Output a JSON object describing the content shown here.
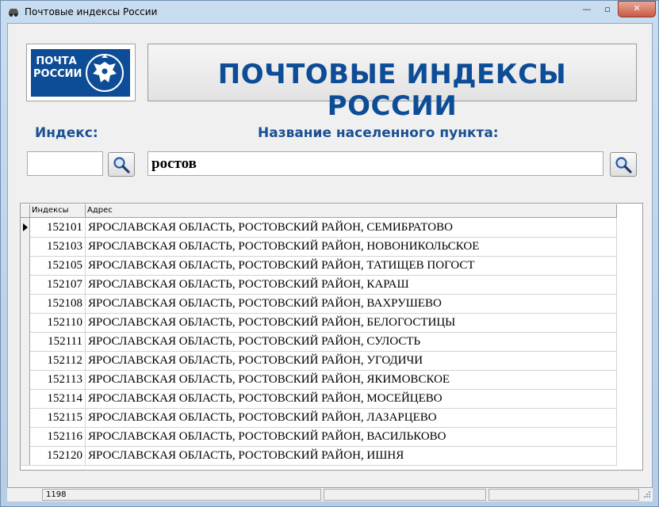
{
  "window": {
    "title": "Почтовые индексы России",
    "buttons": {
      "minimize": "—",
      "maximize": "▫",
      "close": "✕"
    }
  },
  "logo": {
    "line1": "ПОЧТА",
    "line2": "РОССИИ"
  },
  "banner": {
    "text": "ПОЧТОВЫЕ ИНДЕКСЫ РОССИИ"
  },
  "search": {
    "index_label": "Индекс:",
    "index_value": "",
    "place_label": "Название населенного пункта:",
    "place_value": "ростов"
  },
  "grid": {
    "columns": [
      "Индексы",
      "Адрес"
    ],
    "rows": [
      {
        "index": "152101",
        "address": "ЯРОСЛАВСКАЯ ОБЛАСТЬ, РОСТОВСКИЙ РАЙОН, СЕМИБРАТОВО"
      },
      {
        "index": "152103",
        "address": "ЯРОСЛАВСКАЯ ОБЛАСТЬ, РОСТОВСКИЙ РАЙОН, НОВОНИКОЛЬСКОЕ"
      },
      {
        "index": "152105",
        "address": "ЯРОСЛАВСКАЯ ОБЛАСТЬ, РОСТОВСКИЙ РАЙОН, ТАТИЩЕВ ПОГОСТ"
      },
      {
        "index": "152107",
        "address": "ЯРОСЛАВСКАЯ ОБЛАСТЬ, РОСТОВСКИЙ РАЙОН, КАРАШ"
      },
      {
        "index": "152108",
        "address": "ЯРОСЛАВСКАЯ ОБЛАСТЬ, РОСТОВСКИЙ РАЙОН, ВАХРУШЕВО"
      },
      {
        "index": "152110",
        "address": "ЯРОСЛАВСКАЯ ОБЛАСТЬ, РОСТОВСКИЙ РАЙОН, БЕЛОГОСТИЦЫ"
      },
      {
        "index": "152111",
        "address": "ЯРОСЛАВСКАЯ ОБЛАСТЬ, РОСТОВСКИЙ РАЙОН, СУЛОСТЬ"
      },
      {
        "index": "152112",
        "address": "ЯРОСЛАВСКАЯ ОБЛАСТЬ, РОСТОВСКИЙ РАЙОН, УГОДИЧИ"
      },
      {
        "index": "152113",
        "address": "ЯРОСЛАВСКАЯ ОБЛАСТЬ, РОСТОВСКИЙ РАЙОН, ЯКИМОВСКОЕ"
      },
      {
        "index": "152114",
        "address": "ЯРОСЛАВСКАЯ ОБЛАСТЬ, РОСТОВСКИЙ РАЙОН, МОСЕЙЦЕВО"
      },
      {
        "index": "152115",
        "address": "ЯРОСЛАВСКАЯ ОБЛАСТЬ, РОСТОВСКИЙ РАЙОН, ЛАЗАРЦЕВО"
      },
      {
        "index": "152116",
        "address": "ЯРОСЛАВСКАЯ ОБЛАСТЬ, РОСТОВСКИЙ РАЙОН, ВАСИЛЬКОВО"
      },
      {
        "index": "152120",
        "address": "ЯРОСЛАВСКАЯ ОБЛАСТЬ, РОСТОВСКИЙ РАЙОН, ИШНЯ"
      }
    ]
  },
  "status": {
    "count": "1198"
  },
  "colors": {
    "brand_blue": "#0d4c96",
    "label_blue": "#1a4f93"
  },
  "icons": {
    "app": "car-icon",
    "search": "magnifier-icon"
  }
}
